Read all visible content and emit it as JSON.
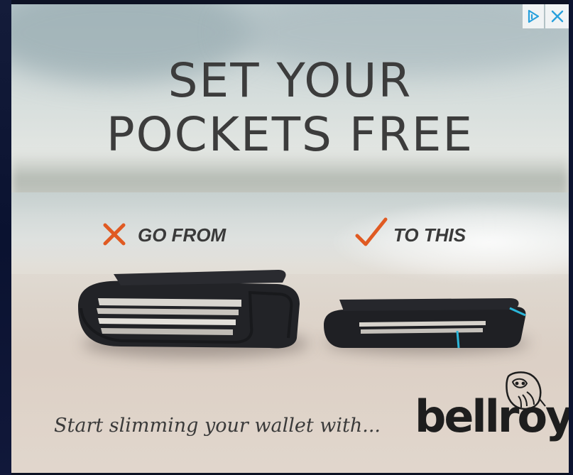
{
  "ad": {
    "headline_line1": "SET YOUR",
    "headline_line2": "POCKETS FREE",
    "from_label": "GO FROM",
    "to_label": "TO THIS",
    "tagline": "Start slimming your wallet with...",
    "brand": "bellroy"
  },
  "controls": {
    "adchoices_icon": "adchoices-icon",
    "close_icon": "close-icon"
  },
  "colors": {
    "accent_orange": "#e05a22",
    "ad_control_blue": "#27a0dc",
    "wallet_black": "#1f2024",
    "wallet_blue_edge": "#2bb6d9"
  }
}
